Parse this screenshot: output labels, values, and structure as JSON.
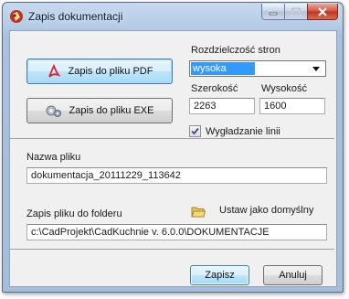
{
  "window": {
    "title": "Zapis dokumentacji"
  },
  "buttons": {
    "pdf_label": "Zapis do pliku PDF",
    "exe_label": "Zapis do pliku EXE",
    "ok_label": "Zapisz",
    "cancel_label": "Anuluj",
    "set_default_label": "Ustaw jako domyślny"
  },
  "resolution": {
    "label": "Rozdzielczość stron",
    "selected": "wysoka",
    "width_label": "Szerokość",
    "width_value": "2263",
    "height_label": "Wysokość",
    "height_value": "1600",
    "smoothing_label": "Wygładzanie linii",
    "smoothing_checked": true
  },
  "file": {
    "name_label": "Nazwa pliku",
    "name_value": "dokumentacja_20111229_113642",
    "folder_label": "Zapis pliku do folderu",
    "folder_value": "c:\\CadProjekt\\CadKuchnie v. 6.0.0\\DOKUMENTACJE"
  },
  "icons": {
    "app": "app-icon",
    "pdf": "pdf-icon",
    "exe": "exe-icon",
    "folder": "folder-icon",
    "check": "check-icon"
  },
  "colors": {
    "selection": "#3399ff",
    "pdf_red": "#d8232a",
    "close_red": "#c2331e",
    "folder_yellow": "#e8c65a"
  }
}
